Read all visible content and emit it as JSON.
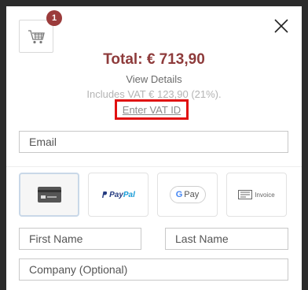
{
  "cart": {
    "badge_count": "1",
    "icon": "cart-icon"
  },
  "close": {
    "icon": "close-icon"
  },
  "summary": {
    "total_label": "Total:",
    "total_value": "€ 713,90",
    "view_details": "View Details",
    "vat_info": "Includes VAT € 123,90 (21%).",
    "enter_vat_id": "Enter VAT ID"
  },
  "form": {
    "email_placeholder": "Email",
    "first_name_placeholder": "First Name",
    "last_name_placeholder": "Last Name",
    "company_placeholder": "Company (Optional)"
  },
  "payment_methods": {
    "card": {
      "icon": "credit-card-icon"
    },
    "paypal": {
      "label_a": "Pay",
      "label_b": "Pal"
    },
    "gpay": {
      "label": "Pay"
    },
    "invoice": {
      "label": "Invoice"
    }
  },
  "colors": {
    "accent": "#8e3b3b",
    "badge": "#9b3b3b",
    "highlight_box": "#e01010"
  }
}
